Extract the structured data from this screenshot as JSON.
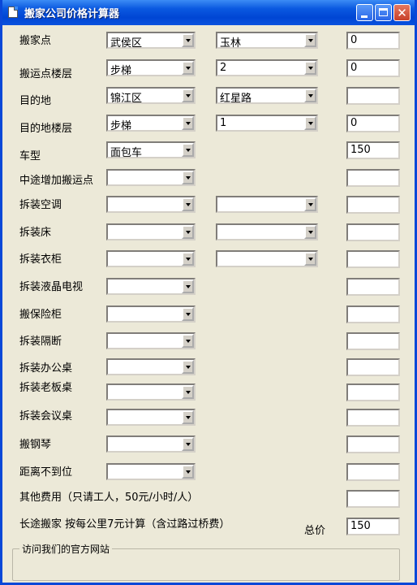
{
  "window": {
    "title": "搬家公司价格计算器"
  },
  "rows": [
    {
      "label": "搬家点",
      "cb1": "武侯区",
      "cb2": "玉林",
      "text": "0"
    },
    {
      "label": "搬运点楼层",
      "cb1": "步梯",
      "cb2": "2",
      "text": "0"
    },
    {
      "label": "目的地",
      "cb1": "锦江区",
      "cb2": "红星路",
      "text": ""
    },
    {
      "label": "目的地楼层",
      "cb1": "步梯",
      "cb2": "1",
      "text": "0"
    },
    {
      "label": "车型",
      "cb1": "面包车",
      "text": "150"
    },
    {
      "label": "中途增加搬运点",
      "cb1": "",
      "text": ""
    },
    {
      "label": "拆装空调",
      "cb1": "",
      "cb2": "",
      "text": ""
    },
    {
      "label": "拆装床",
      "cb1": "",
      "cb2": "",
      "text": ""
    },
    {
      "label": "拆装衣柜",
      "cb1": "",
      "cb2": "",
      "text": ""
    },
    {
      "label": "拆装液晶电视",
      "cb1": "",
      "text": ""
    },
    {
      "label": "搬保险柜",
      "cb1": "",
      "text": ""
    },
    {
      "label": "拆装隔断",
      "cb1": "",
      "text": ""
    },
    {
      "label": "拆装办公桌",
      "cb1": "",
      "text": ""
    },
    {
      "label": "拆装老板桌",
      "cb1": "",
      "text": ""
    },
    {
      "label": "拆装会议桌",
      "cb1": "",
      "text": ""
    },
    {
      "label": "搬钢琴",
      "cb1": "",
      "text": ""
    },
    {
      "label": "距离不到位",
      "cb1": "",
      "text": ""
    }
  ],
  "other": {
    "label": "其他费用（只请工人，50元/小时/人）",
    "text": ""
  },
  "long_distance": {
    "label": "长途搬家  按每公里7元计算（含过路过桥费）",
    "total_label": "总价",
    "total": "150"
  },
  "website_frame": {
    "label": "访问我们的官方网站"
  }
}
